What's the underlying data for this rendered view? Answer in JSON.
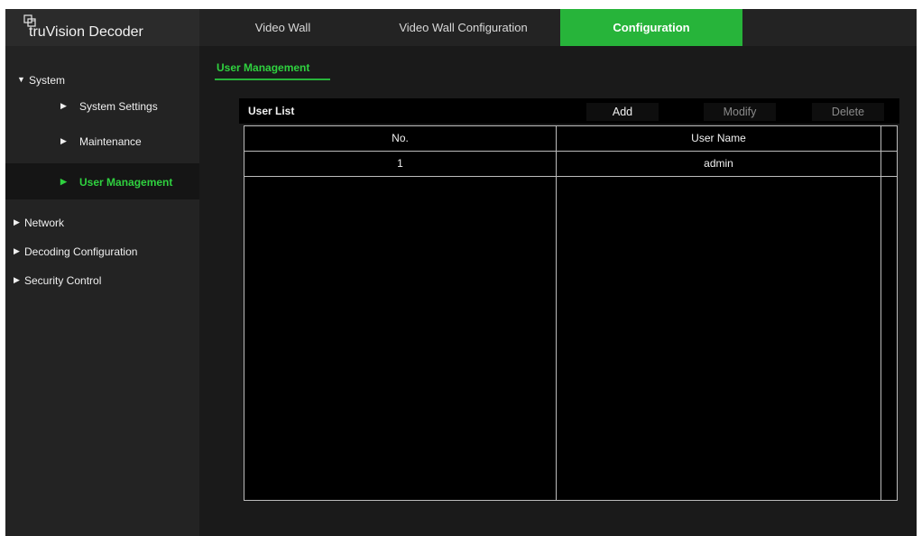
{
  "header": {
    "app_title": "truVision Decoder",
    "tabs": [
      "Video Wall",
      "Video Wall Configuration",
      "Configuration"
    ],
    "active_tab": "Configuration"
  },
  "sidebar": {
    "system": "System",
    "system_settings": "System Settings",
    "maintenance": "Maintenance",
    "user_management": "User Management",
    "network": "Network",
    "decoding_configuration": "Decoding Configuration",
    "security_control": "Security Control"
  },
  "content": {
    "subtab": "User Management",
    "user_list_title": "User List",
    "buttons": {
      "add": "Add",
      "modify": "Modify",
      "delete": "Delete"
    },
    "table": {
      "headers": [
        "No.",
        "User Name"
      ],
      "rows": [
        [
          "1",
          "admin"
        ]
      ]
    }
  },
  "colors": {
    "accent": "#27b43a",
    "active_text": "#2fd13f",
    "background": "#1a1a1a"
  }
}
